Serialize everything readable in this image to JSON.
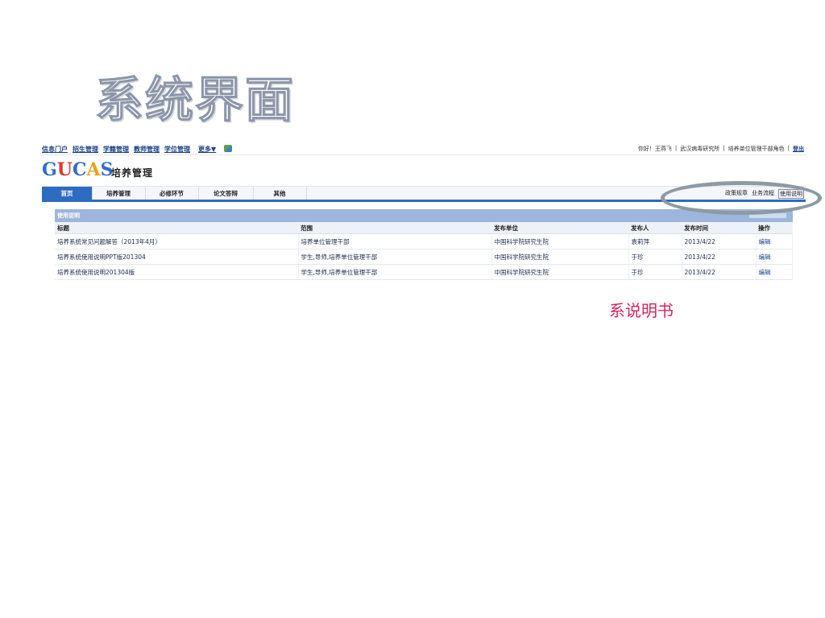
{
  "slide": {
    "title": "系统界面",
    "caption": "系说明书"
  },
  "topnav": {
    "items": [
      "信息门户",
      "招生管理",
      "学籍管理",
      "教师管理",
      "学位管理",
      "更多▼"
    ],
    "tree_icon": "tree-icon"
  },
  "userbar": {
    "greeting": "你好！王燕飞",
    "org": "武汉病毒研究所",
    "role": "培养单位管理干部角色",
    "logout": "登出"
  },
  "logo": {
    "g": "G",
    "u": "U",
    "c": "C",
    "a": "A",
    "s": "S",
    "subtitle": "培养管理"
  },
  "tabs": [
    "首页",
    "培养管理",
    "必修环节",
    "论文答辩",
    "其他"
  ],
  "right_links": [
    "政策规章",
    "业务流程",
    "使用说明"
  ],
  "panel": {
    "title": "使用说明",
    "columns": [
      "标题",
      "范围",
      "发布单位",
      "发布人",
      "发布时间",
      "操作"
    ],
    "rows": [
      [
        "培养系统常见问题解答（2013年4月）",
        "培养单位管理干部",
        "中国科学院研究生院",
        "袁莉萍",
        "2013/4/22",
        "编辑"
      ],
      [
        "培养系统使用说明PPT版201304",
        "学生,导师,培养单位管理干部",
        "中国科学院研究生院",
        "于珍",
        "2013/4/22",
        "编辑"
      ],
      [
        "培养系统使用说明201304版",
        "学生,导师,培养单位管理干部",
        "中国科学院研究生院",
        "于珍",
        "2013/4/22",
        "编辑"
      ]
    ]
  },
  "colors": {
    "accent": "#2d6cc0",
    "panel_header": "#9eb6dc",
    "caption": "#d4245f",
    "ellipse": "#8c9aa4"
  }
}
